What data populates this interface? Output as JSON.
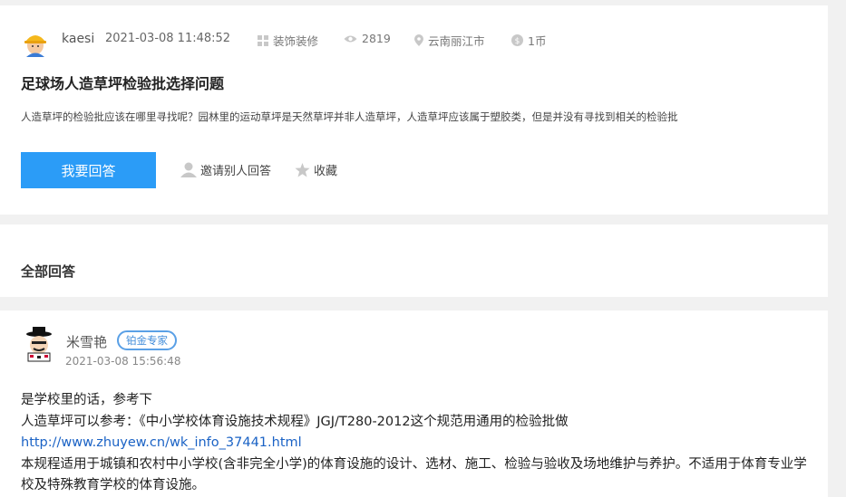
{
  "question": {
    "author": "kaesi",
    "time": "2021-03-08 11:48:52",
    "category": "装饰装修",
    "views": "2819",
    "location": "云南丽江市",
    "reward": "1币",
    "title": "足球场人造草坪检验批选择问题",
    "body": "人造草坪的检验批应该在哪里寻找呢？园林里的运动草坪是天然草坪并非人造草坪，人造草坪应该属于塑胶类，但是并没有寻找到相关的检验批",
    "icons": {
      "category": "grid-icon",
      "views": "eye-icon",
      "location": "location-pin-icon",
      "reward": "coin-icon"
    }
  },
  "actions": {
    "answer_label": "我要回答",
    "invite_label": "邀请别人回答",
    "favorite_label": "收藏"
  },
  "all_answers": {
    "title": "全部回答"
  },
  "answer": {
    "author": "米雪艳",
    "badge": "铂金专家",
    "time": "2021-03-08 15:56:48",
    "line1": "是学校里的话，参考下",
    "line2": "人造草坪可以参考：《中小学校体育设施技术规程》JGJ/T280-2012这个规范用通用的检验批做",
    "link": "http://www.zhuyew.cn/wk_info_37441.html",
    "line3": "本规程适用于城镇和农村中小学校(含非完全小学)的体育设施的设计、选材、施工、检验与验收及场地维护与养护。不适用于体育专业学校及特殊教育学校的体育设施。"
  },
  "colors": {
    "accent": "#2b9cf7",
    "badge_border": "#5aa0e6",
    "link": "#1a62c5"
  }
}
